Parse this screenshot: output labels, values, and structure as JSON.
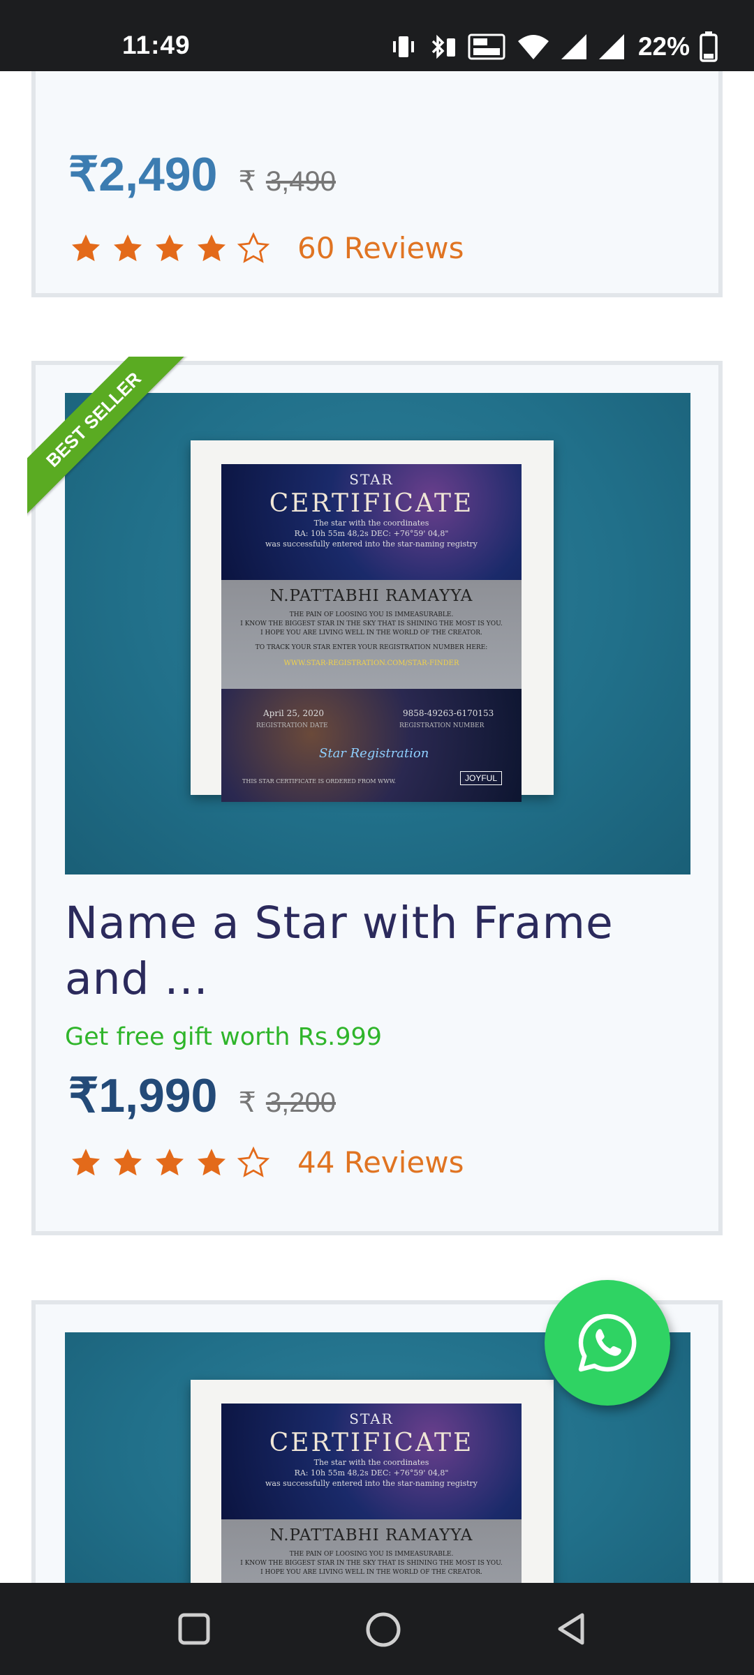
{
  "status_bar": {
    "time": "11:49",
    "battery": "22%",
    "icons": [
      "vibrate-icon",
      "bluetooth-icon",
      "volte-icon",
      "wifi-icon",
      "signal-icon",
      "signal-icon",
      "battery-icon"
    ]
  },
  "products": [
    {
      "price": "₹2,490",
      "currency_symbol": "₹",
      "old_price": "3,490",
      "rating": 4,
      "max_rating": 5,
      "reviews": "60 Reviews",
      "price_color": "#3c7cb1"
    },
    {
      "badge": "BEST SELLER",
      "title": "Name a Star with Frame and ...",
      "gift": "Get free gift worth Rs.999",
      "price": "₹1,990",
      "currency_symbol": "₹",
      "old_price": "3,200",
      "rating": 4,
      "max_rating": 5,
      "reviews": "44 Reviews",
      "price_color": "#234a78",
      "certificate": {
        "heading": "STAR",
        "title": "CERTIFICATE",
        "line1": "The star with the coordinates",
        "line2": "RA: 10h 55m 48,2s   DEC: +76°59' 04,8\"",
        "line3": "was successfully entered into the star-naming registry",
        "name": "N.PATTABHI RAMAYYA",
        "msg1": "THE PAIN OF LOOSING YOU IS IMMEASURABLE.",
        "msg2": "I KNOW THE BIGGEST STAR IN THE SKY THAT IS SHINING THE MOST IS YOU.",
        "msg3": "I HOPE YOU ARE LIVING WELL IN THE WORLD OF THE CREATOR.",
        "track": "TO TRACK YOUR STAR ENTER YOUR REGISTRATION NUMBER HERE:",
        "link": "WWW.STAR-REGISTRATION.COM/STAR-FINDER",
        "date": "April 25, 2020",
        "number": "9858-49263-6170153",
        "date_label": "REGISTRATION DATE",
        "number_label": "REGISTRATION NUMBER",
        "brand": "Star Registration",
        "footer": "THIS STAR CERTIFICATE IS ORDERED FROM WWW.",
        "logo": "JOYFUL"
      }
    },
    {
      "certificate": {
        "heading": "STAR",
        "title": "CERTIFICATE",
        "line1": "The star with the coordinates",
        "line2": "RA: 10h 55m 48,2s   DEC: +76°59' 04,8\"",
        "line3": "was successfully entered into the star-naming registry",
        "name": "N.PATTABHI RAMAYYA",
        "msg1": "THE PAIN OF LOOSING YOU IS IMMEASURABLE.",
        "msg2": "I KNOW THE BIGGEST STAR IN THE SKY THAT IS SHINING THE MOST IS YOU.",
        "msg3": "I HOPE YOU ARE LIVING WELL IN THE WORLD OF THE CREATOR."
      }
    }
  ],
  "colors": {
    "star": "#e36a1a",
    "reviews": "#e07422",
    "gift": "#2fb52a",
    "title": "#2b2a5c",
    "badge": "#5aab22",
    "whatsapp": "#2fd363"
  },
  "fab": {
    "icon": "whatsapp-icon"
  },
  "nav_bar": {
    "buttons": [
      "recents-square-icon",
      "home-circle-icon",
      "back-triangle-icon"
    ]
  }
}
